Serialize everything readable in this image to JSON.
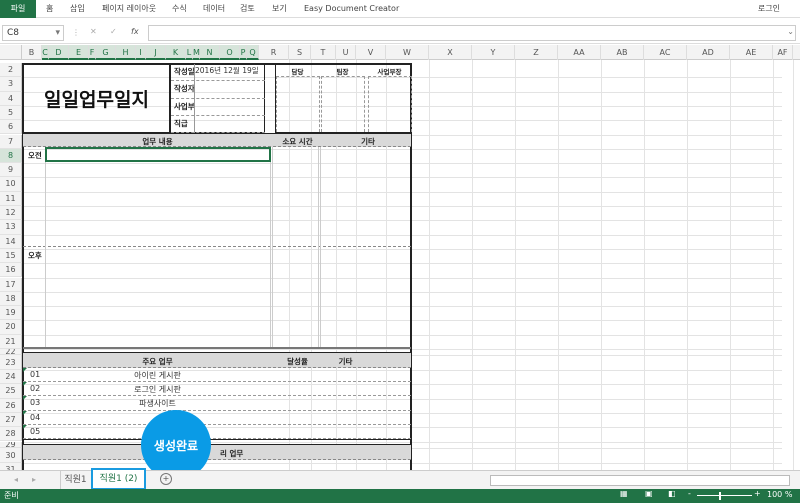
{
  "ribbon": {
    "file": "파일",
    "tabs": [
      "홈",
      "삽입",
      "페이지 레이아웃",
      "수식",
      "데이터",
      "검토",
      "보기",
      "Easy Document Creator"
    ],
    "login": "로그인"
  },
  "formula_bar": {
    "name_box": "C8",
    "fx": "fx",
    "value": ""
  },
  "columns": [
    "B",
    "C",
    "D",
    "E",
    "F",
    "G",
    "H",
    "I",
    "J",
    "K",
    "L",
    "M",
    "N",
    "O",
    "P",
    "Q",
    "R",
    "S",
    "T",
    "U",
    "V",
    "W",
    "X",
    "Y",
    "Z",
    "AA",
    "AB",
    "AC",
    "AD",
    "AE",
    "AF"
  ],
  "rows": [
    "2",
    "3",
    "4",
    "5",
    "6",
    "7",
    "8",
    "9",
    "10",
    "11",
    "12",
    "13",
    "14",
    "15",
    "16",
    "17",
    "18",
    "19",
    "20",
    "21",
    "22",
    "23",
    "24",
    "25",
    "26",
    "27",
    "28",
    "29",
    "30",
    "31"
  ],
  "form": {
    "title": "일일업무일지",
    "info_labels": [
      "작성일",
      "작성자",
      "사업부",
      "직급"
    ],
    "date": "2016년 12월 19일",
    "approvals": [
      "담당",
      "팀장",
      "사업부장"
    ],
    "section1": {
      "content": "업무 내용",
      "time": "소요 시간",
      "etc": "기타",
      "morning": "오전",
      "afternoon": "오후"
    },
    "section2": {
      "main": "주요 업무",
      "rate": "달성율",
      "etc": "기타",
      "items": [
        {
          "no": "01",
          "task": "아이린 게시판"
        },
        {
          "no": "02",
          "task": "로그인 게시판"
        },
        {
          "no": "03",
          "task": "파생사이트"
        },
        {
          "no": "04",
          "task": ""
        },
        {
          "no": "05",
          "task": ""
        }
      ]
    },
    "section3": {
      "title_visible": "리 업무"
    }
  },
  "callout": "생성완료",
  "sheets": {
    "tabs": [
      "직원1",
      "직원1 (2)"
    ],
    "active": 1
  },
  "status": {
    "ready": "준비",
    "zoom": "100 %"
  },
  "colors": {
    "accent": "#217346",
    "callout": "#0a9be6"
  }
}
